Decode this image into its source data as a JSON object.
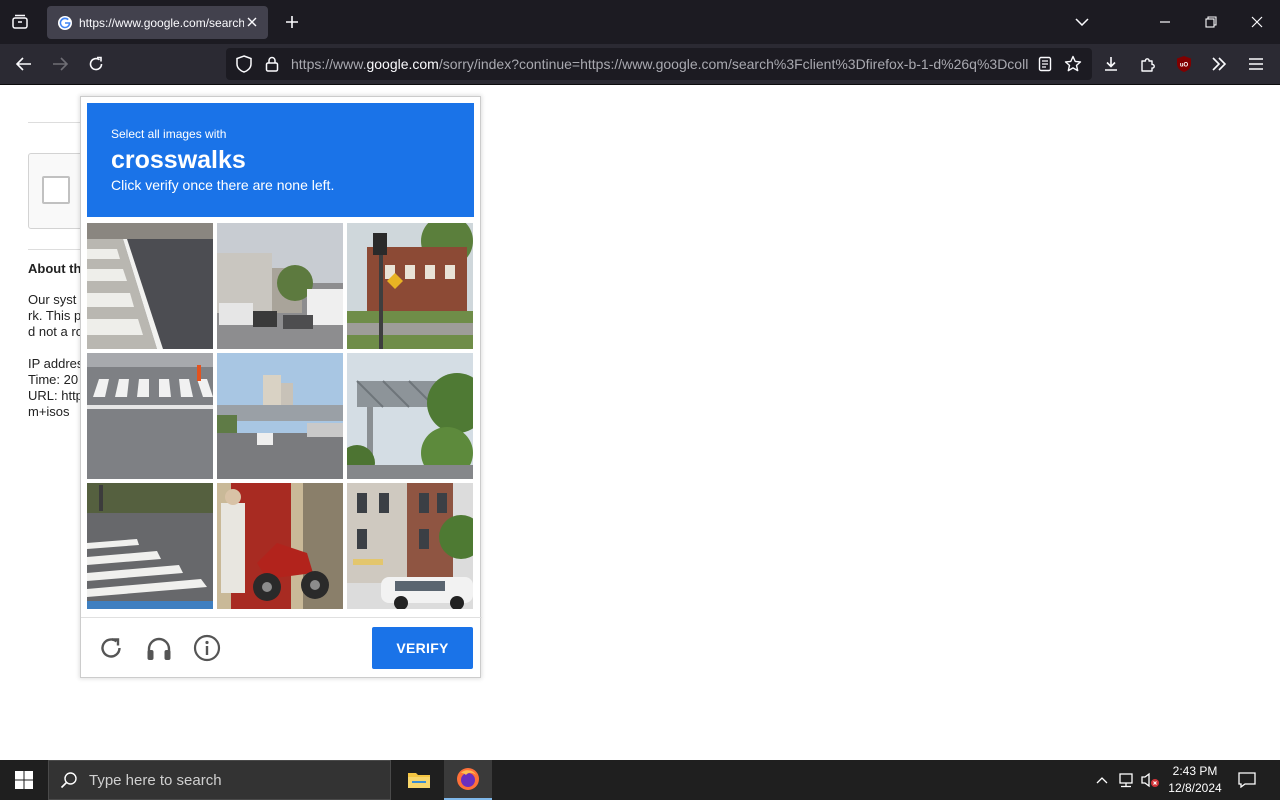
{
  "browser": {
    "tab_title": "https://www.google.com/search?client=firefox",
    "url_prefix": "https://www.",
    "url_domain": "google.com",
    "url_rest": "/sorry/index?continue=https://www.google.com/search%3Fclient%3Dfirefox-b-1-d%26q%3Dcoll"
  },
  "page": {
    "about_heading": "About th",
    "para_lines": [
      "Our syst",
      "rk. This p",
      "d not a ro"
    ],
    "info_lines": [
      "IP addres",
      "Time: 20",
      "URL: http",
      "m+isos"
    ]
  },
  "captcha": {
    "prompt_small": "Select all images with",
    "prompt_object": "crosswalks",
    "prompt_instruction": "Click verify once there are none left.",
    "verify_label": "VERIFY",
    "tiles": [
      {
        "name": "crosswalk-curb"
      },
      {
        "name": "street-trucks"
      },
      {
        "name": "brick-building-traffic-light"
      },
      {
        "name": "crosswalk-stripes"
      },
      {
        "name": "city-road-skyline"
      },
      {
        "name": "pedestrian-bridge"
      },
      {
        "name": "crosswalk-intersection"
      },
      {
        "name": "motorcycle-shop"
      },
      {
        "name": "rowhouses-car"
      }
    ]
  },
  "taskbar": {
    "search_placeholder": "Type here to search",
    "time": "2:43 PM",
    "date": "12/8/2024"
  },
  "colors": {
    "accent": "#1a73e8",
    "browser_dark": "#1c1b22",
    "taskbar": "#1f1f1f"
  }
}
